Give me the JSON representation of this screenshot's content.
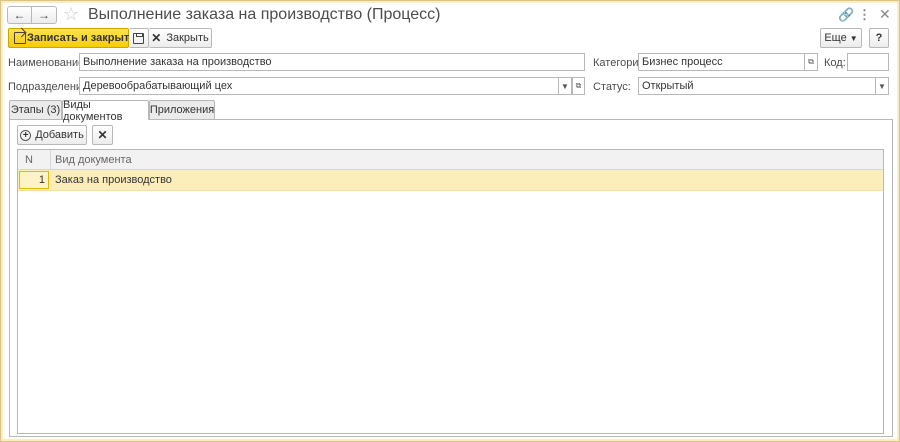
{
  "window": {
    "title": "Выполнение заказа на производство (Процесс)"
  },
  "titlebar": {
    "icons": [
      "back-arrow",
      "forward-arrow",
      "star",
      "link",
      "more-vertical",
      "close"
    ]
  },
  "toolbar": {
    "save_close_label": "Записать и закрыть",
    "close_label": "Закрыть",
    "more_label": "Еще",
    "help_label": "?"
  },
  "form": {
    "name_label": "Наименование:",
    "name_value": "Выполнение заказа на производство",
    "category_label": "Категория:",
    "category_value": "Бизнес процесс",
    "code_label": "Код:",
    "code_value": "",
    "division_label": "Подразделение:",
    "division_value": "Деревообрабатывающий цех",
    "status_label": "Статус:",
    "status_value": "Открытый"
  },
  "tabs": [
    {
      "label": "Этапы (3)",
      "active": false
    },
    {
      "label": "Виды документов",
      "active": true
    },
    {
      "label": "Приложения",
      "active": false
    }
  ],
  "panel": {
    "add_label": "Добавить"
  },
  "table": {
    "columns": [
      "N",
      "Вид документа"
    ],
    "rows": [
      {
        "n": "1",
        "doc_type": "Заказ на производство"
      }
    ]
  },
  "colors": {
    "accent": "#f6cc0b",
    "window_border": "#fbedbe",
    "selected_row": "#fbeebb"
  }
}
